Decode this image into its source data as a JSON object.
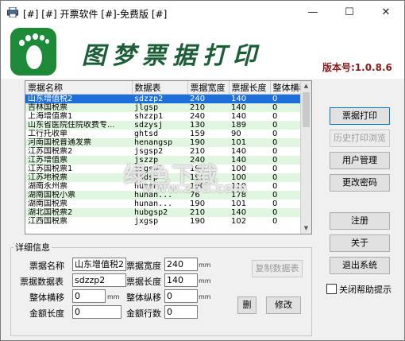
{
  "window": {
    "title": "[#] [#] 开票软件 [#]-免费版 [#]",
    "minimize": "—",
    "maximize": "☐",
    "close": "✕"
  },
  "banner": {
    "app_name": "图梦票据打印",
    "version": "版本号:1.0.8.6"
  },
  "table": {
    "columns": [
      "票据名称",
      "数据表",
      "票据宽度",
      "票据长度",
      "整体横移"
    ],
    "rows": [
      [
        "山东增值税2",
        "sdzzp2",
        "240",
        "140",
        "0"
      ],
      [
        "吉林国税票",
        "jlgsp",
        "210",
        "140",
        "0"
      ],
      [
        "上海增值票1",
        "shzzp1",
        "240",
        "140",
        "0"
      ],
      [
        "山东省医院住院收费专...",
        "sdzysj",
        "130",
        "189",
        "0"
      ],
      [
        "工行托收单",
        "ghtsd",
        "159",
        "90",
        "0"
      ],
      [
        "河南国税普通发票",
        "henangsp",
        "190",
        "101",
        "0"
      ],
      [
        "江苏国税票2",
        "jsgsp2",
        "210",
        "140",
        "0"
      ],
      [
        "江苏增值票",
        "jszzp",
        "240",
        "140",
        "0"
      ],
      [
        "江苏国税票1",
        "jsgsp1",
        "190",
        "100",
        "0"
      ],
      [
        "江苏地税票",
        "jsdsp",
        "190",
        "100",
        "0"
      ],
      [
        "湖南永州票",
        "hunan...",
        "190",
        "110",
        "0"
      ],
      [
        "湖南国税小票",
        "hunan...",
        "76",
        "178",
        "0"
      ],
      [
        "湖南国税票",
        "hunan...",
        "190",
        "101",
        "0"
      ],
      [
        "湖北国税票2",
        "hubgsp2",
        "210",
        "140",
        "0"
      ],
      [
        "江西国税票",
        "jxgsp",
        "190",
        "102",
        "0"
      ]
    ]
  },
  "side_buttons": {
    "print": "票据打印",
    "history": "历史打印浏览",
    "user_mgmt": "用户管理",
    "change_pwd": "更改密码",
    "register": "注册",
    "about": "关于",
    "exit": "退出系统",
    "close_help": "关闭帮助提示"
  },
  "details": {
    "group_title": "详细信息",
    "name_label": "票据名称",
    "name_value": "山东增值税2",
    "width_label": "票据宽度",
    "width_value": "240",
    "table_label": "票据数据表",
    "table_value": "sdzzp2",
    "length_label": "票据长度",
    "length_value": "140",
    "hshift_label": "整体横移",
    "hshift_value": "0",
    "vshift_label": "整体纵移",
    "vshift_value": "0",
    "amt_len_label": "金额长度",
    "amt_len_value": "0",
    "amt_row_label": "金额行数",
    "amt_row_value": "0",
    "unit_mm": "mm",
    "copy_button": "复制数据表",
    "delete_button": "删",
    "modify_button": "修改"
  },
  "watermark": {
    "line1": "绿色下载",
    "line2": "www.z6u.com"
  },
  "colors": {
    "selection": "#1e6fd9",
    "alt_row": "#e1f6e1",
    "logo_green": "#1c8a36",
    "version_red": "#8b1a1a"
  }
}
